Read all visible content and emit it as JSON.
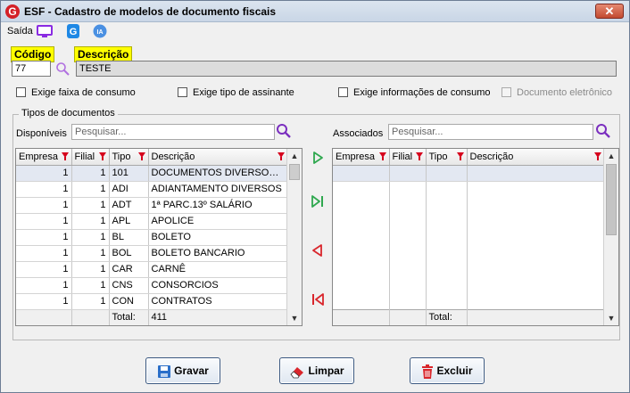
{
  "window": {
    "title": "ESF - Cadastro de modelos de documento fiscais",
    "close_glyph": "✕"
  },
  "toolbar": {
    "saida_label": "Saída",
    "icons": [
      "monitor-icon",
      "g-app-icon",
      "ia-icon"
    ],
    "ia_label": "IA"
  },
  "form": {
    "codigo_label": "Código",
    "codigo_value": "77",
    "descricao_label": "Descrição",
    "descricao_value": "TESTE"
  },
  "options": {
    "faixa_consumo": "Exige faixa de consumo",
    "tipo_assinante": "Exige tipo de assinante",
    "info_consumo": "Exige informações de consumo",
    "doc_eletronico": "Documento eletrônico"
  },
  "tipos": {
    "group_title": "Tipos de documentos",
    "disponiveis_label": "Disponíveis",
    "associados_label": "Associados",
    "search_placeholder": "Pesquisar...",
    "columns": {
      "empresa": "Empresa",
      "filial": "Filial",
      "tipo": "Tipo",
      "descricao": "Descrição"
    },
    "available_rows": [
      {
        "empresa": "1",
        "filial": "1",
        "tipo": "101",
        "descricao": "DOCUMENTOS DIVERSOS ..."
      },
      {
        "empresa": "1",
        "filial": "1",
        "tipo": "ADI",
        "descricao": "ADIANTAMENTO DIVERSOS"
      },
      {
        "empresa": "1",
        "filial": "1",
        "tipo": "ADT",
        "descricao": "1ª PARC.13º SALÁRIO"
      },
      {
        "empresa": "1",
        "filial": "1",
        "tipo": "APL",
        "descricao": "APOLICE"
      },
      {
        "empresa": "1",
        "filial": "1",
        "tipo": "BL",
        "descricao": "BOLETO"
      },
      {
        "empresa": "1",
        "filial": "1",
        "tipo": "BOL",
        "descricao": "BOLETO BANCARIO"
      },
      {
        "empresa": "1",
        "filial": "1",
        "tipo": "CAR",
        "descricao": "CARNÊ"
      },
      {
        "empresa": "1",
        "filial": "1",
        "tipo": "CNS",
        "descricao": "CONSORCIOS"
      },
      {
        "empresa": "1",
        "filial": "1",
        "tipo": "CON",
        "descricao": "CONTRATOS"
      }
    ],
    "total_label": "Total:",
    "available_total": "411",
    "associated_total": ""
  },
  "buttons": {
    "gravar": "Gravar",
    "limpar": "Limpar",
    "excluir": "Excluir"
  },
  "colors": {
    "accent_yellow": "#ffff00",
    "filter_red": "#d6001c",
    "arrow_green": "#2fa84f",
    "arrow_red": "#d9262c",
    "search_purple": "#7b2fbf"
  }
}
